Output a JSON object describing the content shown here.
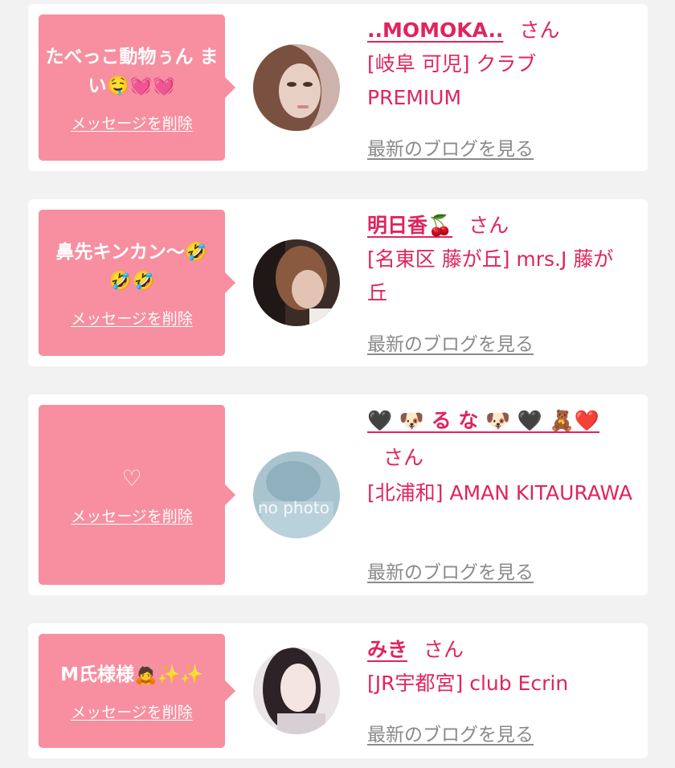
{
  "favorites": [
    {
      "message": "たべっこ動物ぅん まい🤤💓💓",
      "delete_label": "メッセージを削除",
      "name": "..MOMOKA..",
      "san": "さん",
      "shop": "[岐阜 可児] クラブ PREMIUM",
      "blog_link": "最新のブログを見る"
    },
    {
      "message": "鼻先キンカン〜🤣🤣🤣",
      "delete_label": "メッセージを削除",
      "name": "明日香🍒",
      "san": "さん",
      "shop": "[名東区 藤が丘] mrs.J 藤が丘",
      "blog_link": "最新のブログを見る"
    },
    {
      "message": "♡",
      "delete_label": "メッセージを削除",
      "name": "🖤 🐶 る な 🐶 🖤 🧸❤️",
      "san": "さん",
      "avatar_text": "no photo",
      "shop": "[北浦和] AMAN KITAURAWA",
      "blog_link": "最新のブログを見る"
    },
    {
      "message": "M氏様様🙇✨✨",
      "delete_label": "メッセージを削除",
      "name": "みき",
      "san": "さん",
      "shop": "[JR宇都宮] club Ecrin",
      "blog_link": "最新のブログを見る"
    }
  ]
}
